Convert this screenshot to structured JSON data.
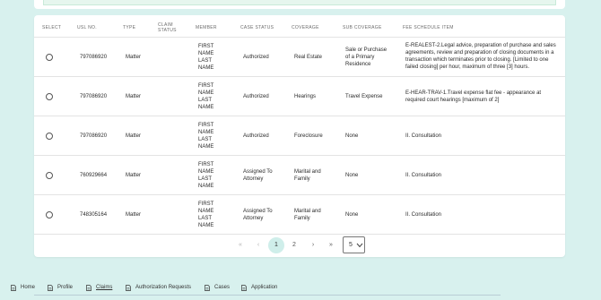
{
  "table": {
    "headers": {
      "select": "SELECT",
      "usl_no": "USL NO.",
      "type": "TYPE",
      "claim_status": "CLAIM STATUS",
      "member": "MEMBER",
      "case_status": "CASE STATUS",
      "coverage": "COVERAGE",
      "sub_coverage": "SUB COVERAGE",
      "fee_schedule_item": "FEE SCHEDULE ITEM"
    },
    "rows": [
      {
        "usl_no": "797086920",
        "type": "Matter",
        "claim_status": "",
        "member": "FIRST\nNAME\nLAST\nNAME",
        "case_status": "Authorized",
        "coverage": "Real Estate",
        "sub_coverage": "Sale or Purchase of a Primary Residence",
        "fee_schedule_item": "E-REALEST-2.Legal advice, preparation of purchase and sales agreements, review and preparation of closing documents in a transaction which terminates prior to closing. [Limited to one failed closing] per hour, maximum of three [3] hours."
      },
      {
        "usl_no": "797086920",
        "type": "Matter",
        "claim_status": "",
        "member": "FIRST\nNAME\nLAST\nNAME",
        "case_status": "Authorized",
        "coverage": "Hearings",
        "sub_coverage": "Travel Expense",
        "fee_schedule_item": "E-HEAR-TRAV-1.Travel expense flat fee - appearance at required court hearings [maximum of 2]"
      },
      {
        "usl_no": "797086920",
        "type": "Matter",
        "claim_status": "",
        "member": "FIRST\nNAME\nLAST\nNAME",
        "case_status": "Authorized",
        "coverage": "Foreclosure",
        "sub_coverage": "None",
        "fee_schedule_item": "II. Consultation"
      },
      {
        "usl_no": "760929664",
        "type": "Matter",
        "claim_status": "",
        "member": "FIRST\nNAME\nLAST\nNAME",
        "case_status": "Assigned To Attorney",
        "coverage": "Marital and Family",
        "sub_coverage": "None",
        "fee_schedule_item": "II. Consultation"
      },
      {
        "usl_no": "748305164",
        "type": "Matter",
        "claim_status": "",
        "member": "FIRST\nNAME\nLAST\nNAME",
        "case_status": "Assigned To Attorney",
        "coverage": "Marital and Family",
        "sub_coverage": "None",
        "fee_schedule_item": "II. Consultation"
      }
    ]
  },
  "pagination": {
    "first": "«",
    "prev": "‹",
    "pages": [
      "1",
      "2"
    ],
    "current_page": "1",
    "next": "›",
    "last": "»",
    "page_size": "5"
  },
  "nav_tabs": [
    {
      "label": "Home",
      "icon": "document-icon"
    },
    {
      "label": "Profile",
      "icon": "document-icon"
    },
    {
      "label": "Claims",
      "icon": "document-icon",
      "active": true
    },
    {
      "label": "Authorization Requests",
      "icon": "document-icon"
    },
    {
      "label": "Cases",
      "icon": "document-icon"
    },
    {
      "label": "Application",
      "icon": "document-icon"
    }
  ],
  "colors": {
    "background": "#d8f1ee",
    "active_page": "#cfeeea",
    "card": "#ffffff"
  }
}
